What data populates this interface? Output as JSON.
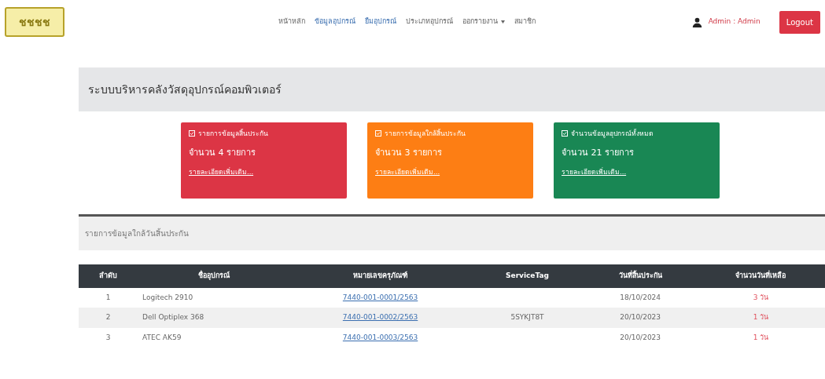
{
  "navbar": {
    "logo": "ชชชช",
    "links": [
      {
        "label": "หน้าหลัก",
        "selected": false,
        "dropdown": false
      },
      {
        "label": "ข้อมูลอุปกรณ์",
        "selected": true,
        "dropdown": false
      },
      {
        "label": "ยืมอุปกรณ์",
        "selected": true,
        "dropdown": false
      },
      {
        "label": "ประเภทอุปกรณ์",
        "selected": false,
        "dropdown": false
      },
      {
        "label": "ออกรายงาน",
        "selected": false,
        "dropdown": true
      },
      {
        "label": "สมาชิก",
        "selected": false,
        "dropdown": false
      }
    ],
    "user": "Admin : Admin",
    "logout": "Logout"
  },
  "title": "ระบบบริหารคลังวัสดุอุปกรณ์คอมพิวเตอร์",
  "cards": [
    {
      "kind": "danger",
      "heading": "รายการข้อมูลสิ้นประกัน",
      "count": "จำนวน 4 รายการ",
      "link": "รายละเอียดเพิ่มเติม..."
    },
    {
      "kind": "warning",
      "heading": "รายการข้อมูลใกล้สิ้นประกัน",
      "count": "จำนวน 3 รายการ",
      "link": "รายละเอียดเพิ่มเติม..."
    },
    {
      "kind": "success",
      "heading": "จำนวนข้อมูลอุปกรณ์ทั้งหมด",
      "count": "จำนวน 21 รายการ",
      "link": "รายละเอียดเพิ่มเติม..."
    }
  ],
  "section": {
    "heading": "รายการข้อมูลใกล้วันสิ้นประกัน"
  },
  "table": {
    "columns": [
      "ลำดับ",
      "ชื่ออุปกรณ์",
      "หมายเลขครุภัณฑ์",
      "ServiceTag",
      "วันที่สิ้นประกัน",
      "จำนวนวันที่เหลือ"
    ],
    "rows": [
      [
        "1",
        "Logitech 2910",
        "7440-001-0001/2563",
        "",
        "18/10/2024",
        "3 วัน"
      ],
      [
        "2",
        "Dell Optiplex 368",
        "7440-001-0002/2563",
        "5SYKJT8T",
        "20/10/2023",
        "1 วัน"
      ],
      [
        "3",
        "ATEC AK59",
        "7440-001-0003/2563",
        "",
        "20/10/2023",
        "1 วัน"
      ]
    ]
  }
}
